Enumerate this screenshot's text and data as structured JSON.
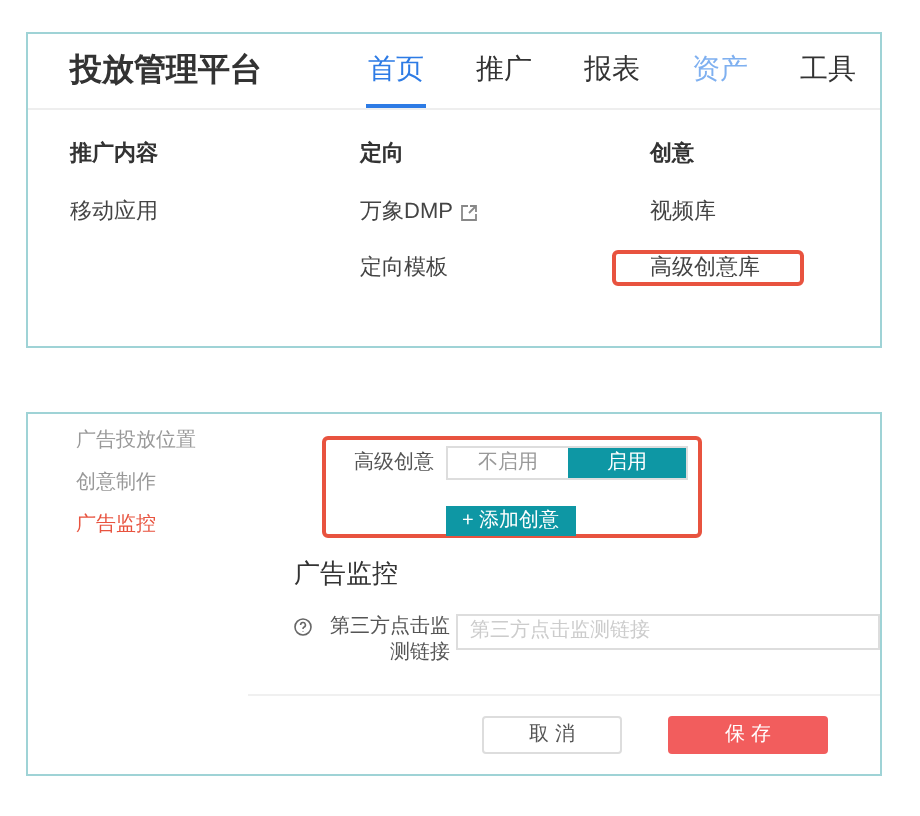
{
  "top_panel": {
    "title": "投放管理平台",
    "nav": [
      {
        "label": "首页",
        "selected": true,
        "hovered": false
      },
      {
        "label": "推广",
        "selected": false,
        "hovered": false
      },
      {
        "label": "报表",
        "selected": false,
        "hovered": false
      },
      {
        "label": "资产",
        "selected": false,
        "hovered": true
      },
      {
        "label": "工具",
        "selected": false,
        "hovered": false
      }
    ],
    "menu_columns": [
      {
        "heading": "推广内容",
        "items": [
          {
            "label": "移动应用",
            "external": false,
            "highlighted": false
          }
        ]
      },
      {
        "heading": "定向",
        "items": [
          {
            "label": "万象DMP",
            "external": true,
            "highlighted": false
          },
          {
            "label": "定向模板",
            "external": false,
            "highlighted": false
          }
        ]
      },
      {
        "heading": "创意",
        "items": [
          {
            "label": "视频库",
            "external": false,
            "highlighted": false
          },
          {
            "label": "高级创意库",
            "external": false,
            "highlighted": true
          }
        ]
      }
    ]
  },
  "bottom_panel": {
    "sidebar": [
      {
        "label": "广告投放位置",
        "selected": false
      },
      {
        "label": "创意制作",
        "selected": false
      },
      {
        "label": "广告监控",
        "selected": true
      }
    ],
    "advanced_creative": {
      "highlighted": true,
      "label": "高级创意",
      "options": [
        {
          "label": "不启用",
          "selected": false
        },
        {
          "label": "启用",
          "selected": true
        }
      ],
      "add_button": "+ 添加创意"
    },
    "section_title": "广告监控",
    "field": {
      "label": "第三方点击监测链接",
      "placeholder": "第三方点击监测链接"
    },
    "buttons": [
      {
        "label": "取 消",
        "kind": "secondary"
      },
      {
        "label": "保 存",
        "kind": "primary"
      }
    ]
  }
}
